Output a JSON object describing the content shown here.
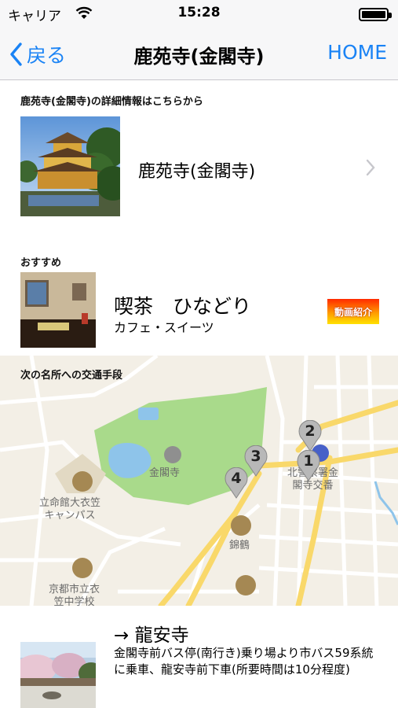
{
  "status_bar": {
    "carrier": "キャリア",
    "time": "15:28"
  },
  "nav": {
    "back_label": "戻る",
    "title": "鹿苑寺(金閣寺)",
    "home_label": "HOME"
  },
  "detail_section": {
    "header": "鹿苑寺(金閣寺)の詳細情報はこちらから",
    "item_label": "鹿苑寺(金閣寺)"
  },
  "recommend_section": {
    "header": "おすすめ",
    "name": "喫茶　ひなどり",
    "category": "カフェ・スイーツ",
    "video_badge": "動画紹介"
  },
  "map_section": {
    "header": "次の名所への交通手段",
    "labels": {
      "kinkakuji": "金閣寺",
      "ritsumeikan": "立命館大衣笠\nキャンパス",
      "police": "北警察署金\n閣寺交番",
      "nishiki": "錦鶴",
      "school": "京都市立衣\n笠中学校"
    },
    "pins": [
      "1",
      "2",
      "3",
      "4"
    ]
  },
  "route_section": {
    "title": "→ 龍安寺",
    "description": "金閣寺前バス停(南行き)乗り場より市バス59系統に乗車、龍安寺前下車(所要時間は10分程度)"
  },
  "colors": {
    "ios_blue": "#1a83f5",
    "park_green": "#a9da8b",
    "water_blue": "#8ec4ea",
    "road_yellow": "#f9d86a"
  }
}
